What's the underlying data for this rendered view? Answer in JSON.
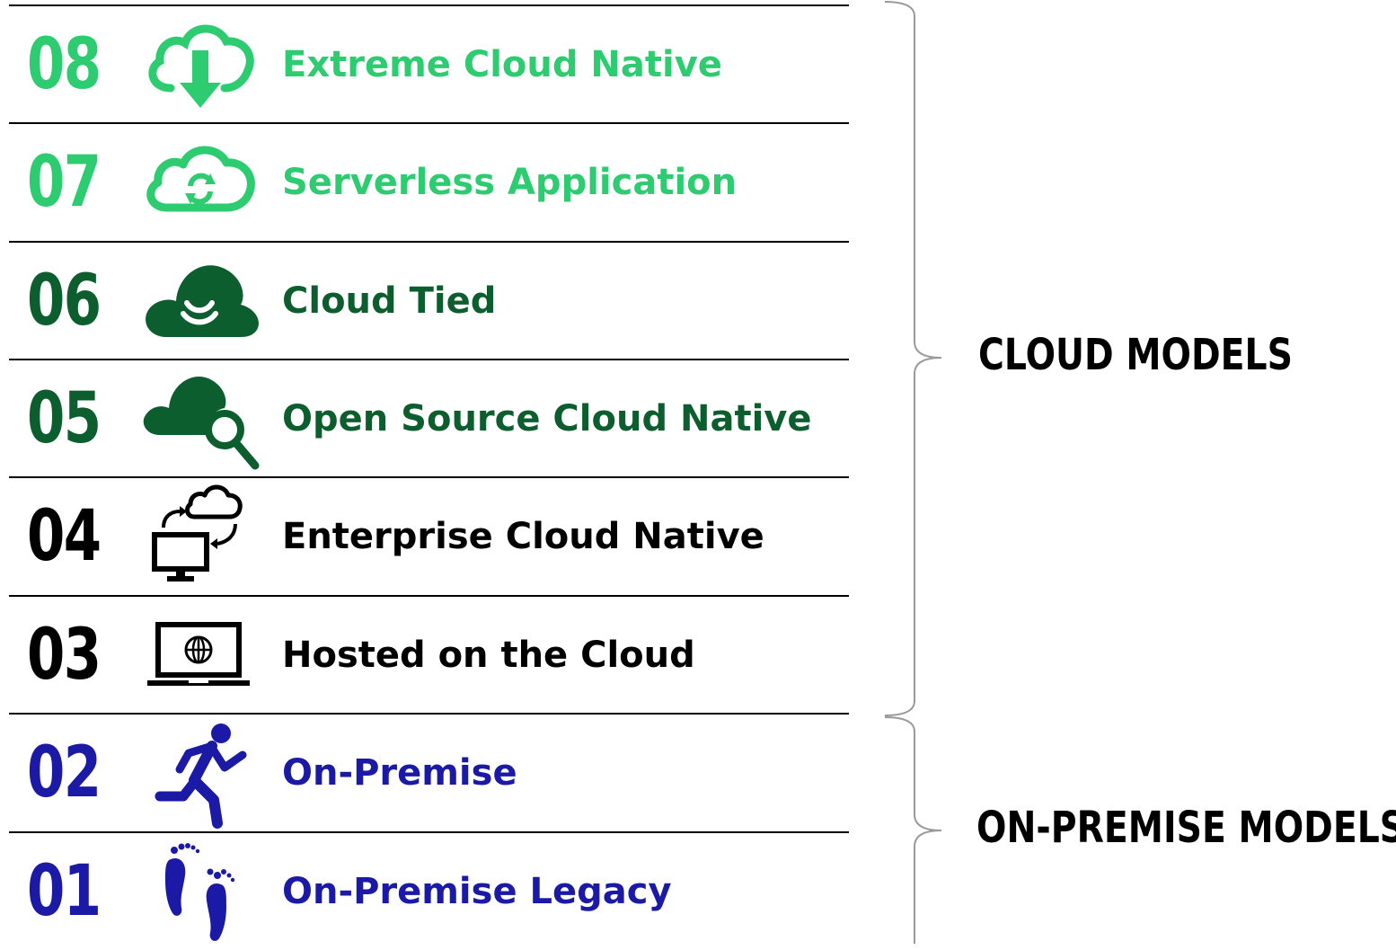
{
  "colors": {
    "light_green": "#2ecc71",
    "dark_green": "#0d5e2e",
    "black": "#000000",
    "blue": "#1a1aa6"
  },
  "groups": {
    "cloud_label": "CLOUD MODELS",
    "onprem_label": "ON-PREMISE MODELS"
  },
  "levels": [
    {
      "number": "08",
      "label": "Extreme Cloud Native",
      "icon": "cloud-download-icon",
      "color": "#2ecc71"
    },
    {
      "number": "07",
      "label": "Serverless Application",
      "icon": "cloud-sync-icon",
      "color": "#2ecc71"
    },
    {
      "number": "06",
      "label": "Cloud Tied",
      "icon": "cloud-signal-icon",
      "color": "#0d5e2e"
    },
    {
      "number": "05",
      "label": "Open Source Cloud Native",
      "icon": "cloud-search-icon",
      "color": "#0d5e2e"
    },
    {
      "number": "04",
      "label": "Enterprise Cloud Native",
      "icon": "monitor-cloud-sync-icon",
      "color": "#000000"
    },
    {
      "number": "03",
      "label": "Hosted on the Cloud",
      "icon": "laptop-globe-icon",
      "color": "#000000"
    },
    {
      "number": "02",
      "label": "On-Premise",
      "icon": "running-person-icon",
      "color": "#1a1aa6"
    },
    {
      "number": "01",
      "label": "On-Premise Legacy",
      "icon": "footprints-icon",
      "color": "#1a1aa6"
    }
  ]
}
